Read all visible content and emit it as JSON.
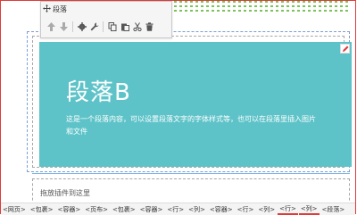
{
  "toolbar": {
    "title": "段落",
    "buttons": [
      "move-up",
      "move-down",
      "settings",
      "wrench",
      "copy",
      "paste",
      "cut",
      "delete"
    ]
  },
  "hero": {
    "title": "段落B",
    "body": "这是一个段落内容，可以设置段落文字的字体样式等，也可以在段落里插入图片和文件"
  },
  "dropzone": {
    "text": "拖放插件到这里"
  },
  "breadcrumb": [
    {
      "label": "<网页>"
    },
    {
      "label": "<包裹>"
    },
    {
      "label": "<容器>"
    },
    {
      "label": "<页布>"
    },
    {
      "label": "<包裹>"
    },
    {
      "label": "<容器>"
    },
    {
      "label": "<行>"
    },
    {
      "label": "<列>"
    },
    {
      "label": "<容器>"
    },
    {
      "label": "<行>"
    },
    {
      "label": "<列>"
    },
    {
      "label": "<行>",
      "active": true
    },
    {
      "label": "<列>",
      "active": true
    },
    {
      "label": "<段落>"
    }
  ],
  "colors": {
    "hero_bg": "#5ec3c8",
    "accent_red": "#e03b3b"
  }
}
